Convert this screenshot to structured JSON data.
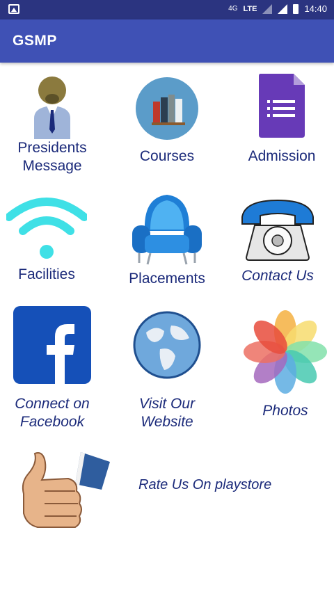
{
  "status_bar": {
    "network": "4G",
    "lte": "LTE",
    "time": "14:40"
  },
  "app_bar": {
    "title": "GSMP"
  },
  "menu": [
    {
      "label": "Presidents\nMessage",
      "icon": "presidents-message-icon"
    },
    {
      "label": "Courses",
      "icon": "books-icon"
    },
    {
      "label": "Admission",
      "icon": "form-icon"
    },
    {
      "label": "Facilities",
      "icon": "wifi-icon"
    },
    {
      "label": "Placements",
      "icon": "armchair-icon"
    },
    {
      "label": "Contact Us",
      "icon": "telephone-icon"
    },
    {
      "label": "Connect on\nFacebook",
      "icon": "facebook-icon"
    },
    {
      "label": "Visit Our\nWebsite",
      "icon": "globe-icon"
    },
    {
      "label": "Photos",
      "icon": "photos-icon"
    }
  ],
  "rate": {
    "label": "Rate Us On playstore",
    "icon": "thumbs-up-icon"
  },
  "colors": {
    "status_bar": "#2b3480",
    "app_bar": "#3f51b5",
    "label_text": "#1b2a7a"
  }
}
